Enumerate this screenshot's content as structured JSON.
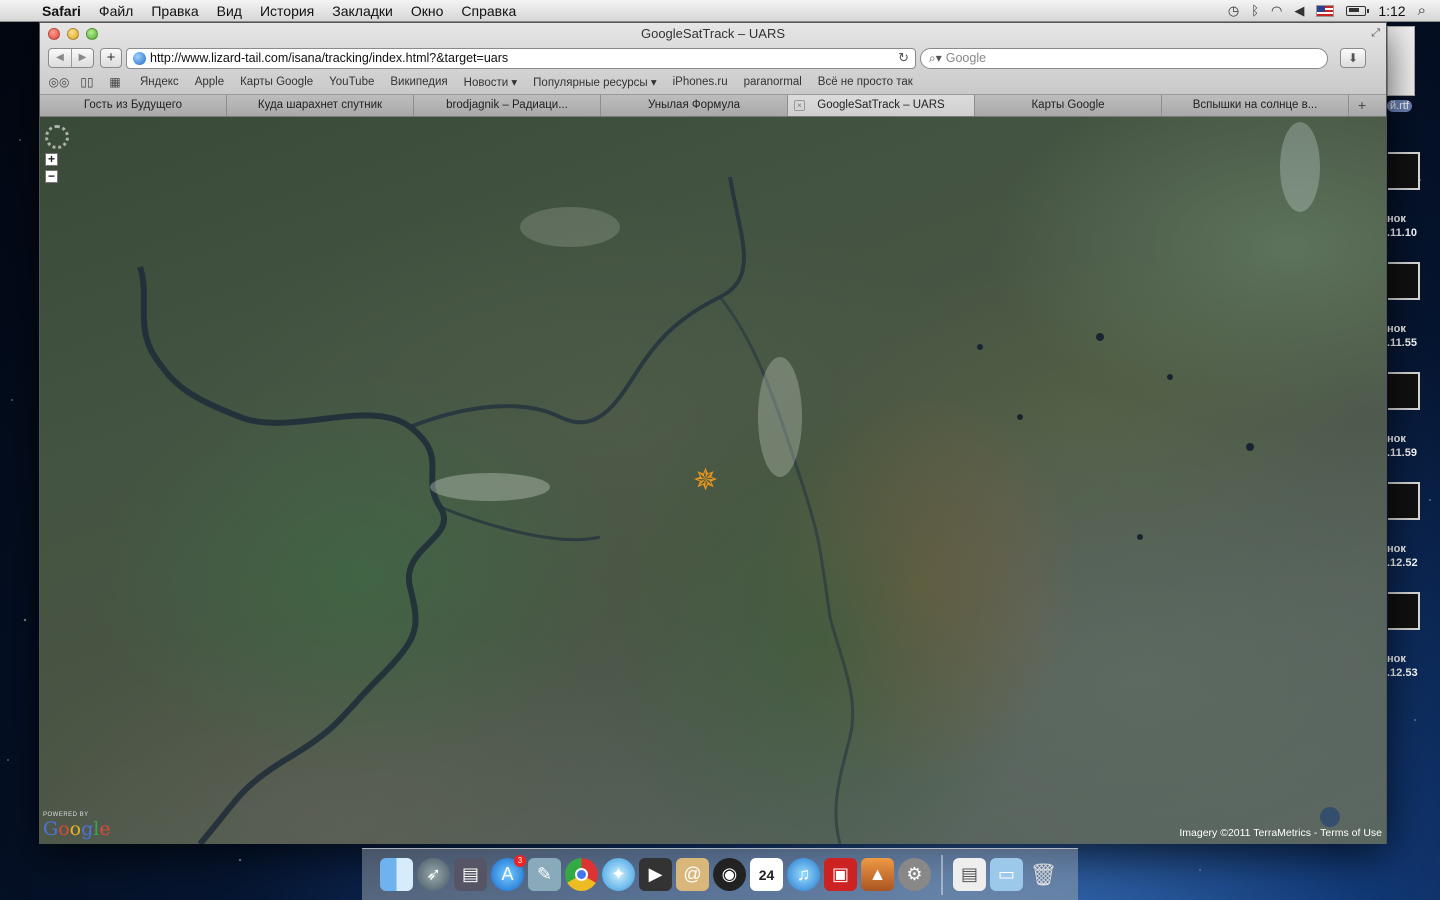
{
  "menubar": {
    "app": "Safari",
    "items": [
      "Файл",
      "Правка",
      "Вид",
      "История",
      "Закладки",
      "Окно",
      "Справка"
    ],
    "clock": "1:12"
  },
  "window": {
    "title": "GoogleSatTrack – UARS",
    "url": "http://www.lizard-tail.com/isana/tracking/index.html?&target=uars",
    "search_placeholder": "Google"
  },
  "bookmarks": [
    "Яндекс",
    "Apple",
    "Карты Google",
    "YouTube",
    "Википедия",
    "Новости ▾",
    "Популярные ресурсы ▾",
    "iPhones.ru",
    "paranormal",
    "Всё не просто так"
  ],
  "tabs": [
    {
      "label": "Гость из Будущего",
      "active": false
    },
    {
      "label": "Куда шарахнет спутник",
      "active": false
    },
    {
      "label": "brodjagnik – Радиаци...",
      "active": false
    },
    {
      "label": "Унылая Формула",
      "active": false
    },
    {
      "label": "GoogleSatTrack – UARS",
      "active": true
    },
    {
      "label": "Карты Google",
      "active": false
    },
    {
      "label": "Вспышки на солнце в...",
      "active": false
    }
  ],
  "map": {
    "powered_by": "POWERED BY",
    "logo": "Google",
    "attribution": "Imagery ©2011 TerraMetrics - Terms of Use"
  },
  "desktop": {
    "rtf": "й.rtf",
    "items": [
      {
        "line1": "нок",
        "line2": ".11.10"
      },
      {
        "line1": "нок",
        "line2": ".11.55"
      },
      {
        "line1": "нок",
        "line2": ".11.59"
      },
      {
        "line1": "нок",
        "line2": ".12.52"
      },
      {
        "line1": "нок",
        "line2": ".12.53"
      }
    ]
  },
  "dock": {
    "calendar_day": "24",
    "appstore_badge": "3",
    "icons": [
      "finder-icon",
      "launchpad-icon",
      "photo-browser-icon",
      "app-store-icon",
      "preview-icon",
      "chrome-icon",
      "safari-icon",
      "facetime-icon",
      "mail-icon",
      "dvd-player-icon",
      "calendar-icon",
      "itunes-icon",
      "photo-booth-icon",
      "iphoto-icon",
      "system-preferences-icon",
      "documents-icon",
      "folder-icon",
      "trash-icon"
    ]
  }
}
